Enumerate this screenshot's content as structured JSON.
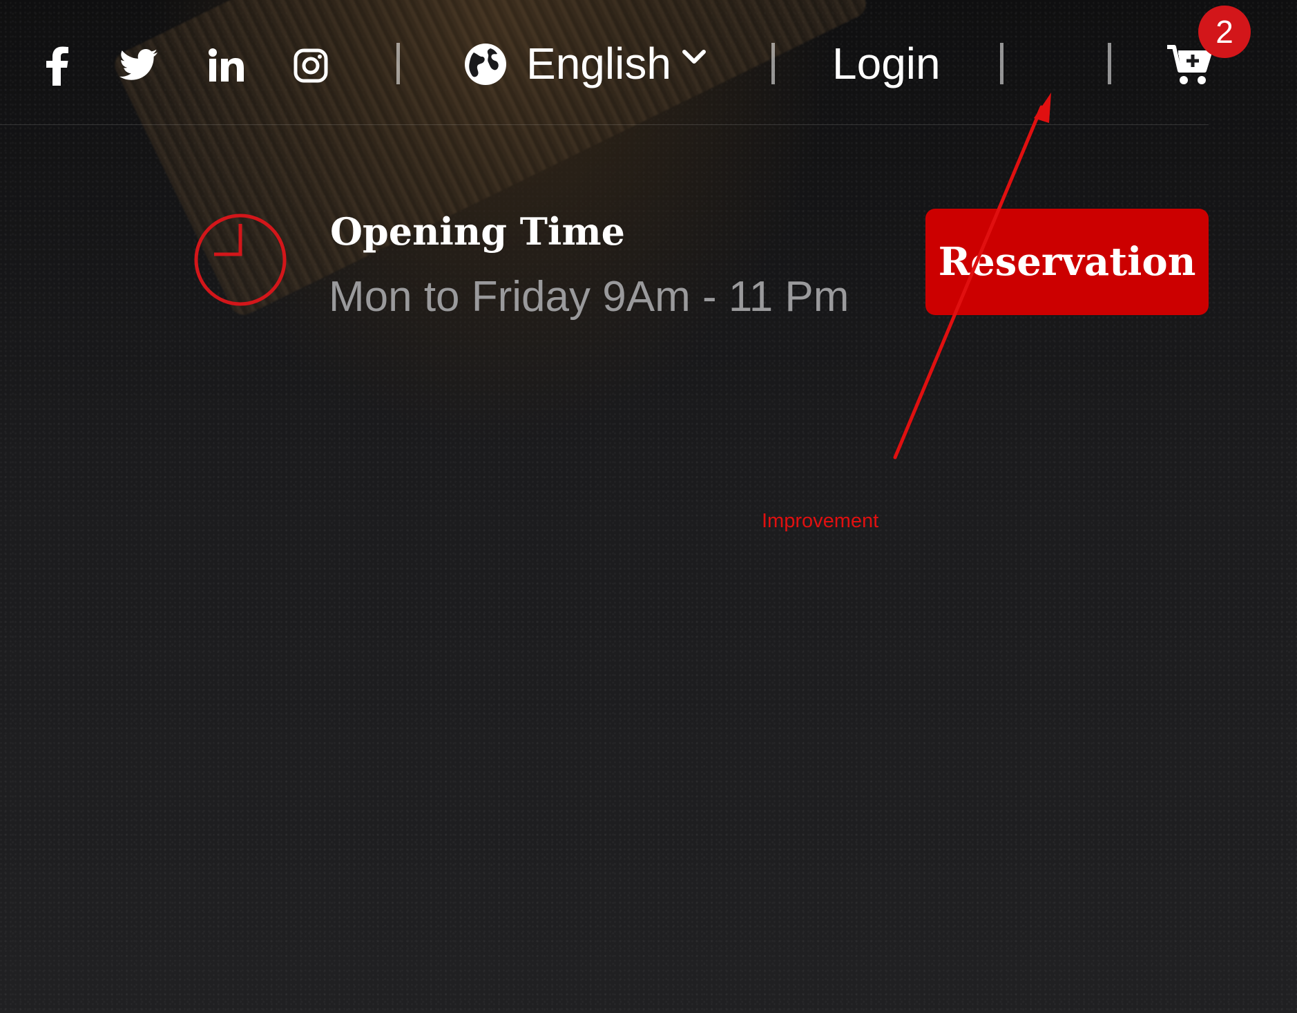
{
  "social": {
    "icons": [
      "facebook-icon",
      "twitter-icon",
      "linkedin-icon",
      "instagram-icon"
    ]
  },
  "language": {
    "selected": "English",
    "icon": "globe-icon"
  },
  "auth": {
    "login_label": "Login"
  },
  "cart": {
    "icon": "cart-icon",
    "count": "2",
    "badge_color": "#d3161a"
  },
  "opening": {
    "icon": "clock-icon",
    "title": "Opening Time",
    "hours": "Mon to Friday 9Am - 11 Pm"
  },
  "cta": {
    "reservation_label": "Reservation",
    "color": "#cc0000"
  },
  "annotation": {
    "label": "Improvement",
    "color": "#e01010"
  }
}
